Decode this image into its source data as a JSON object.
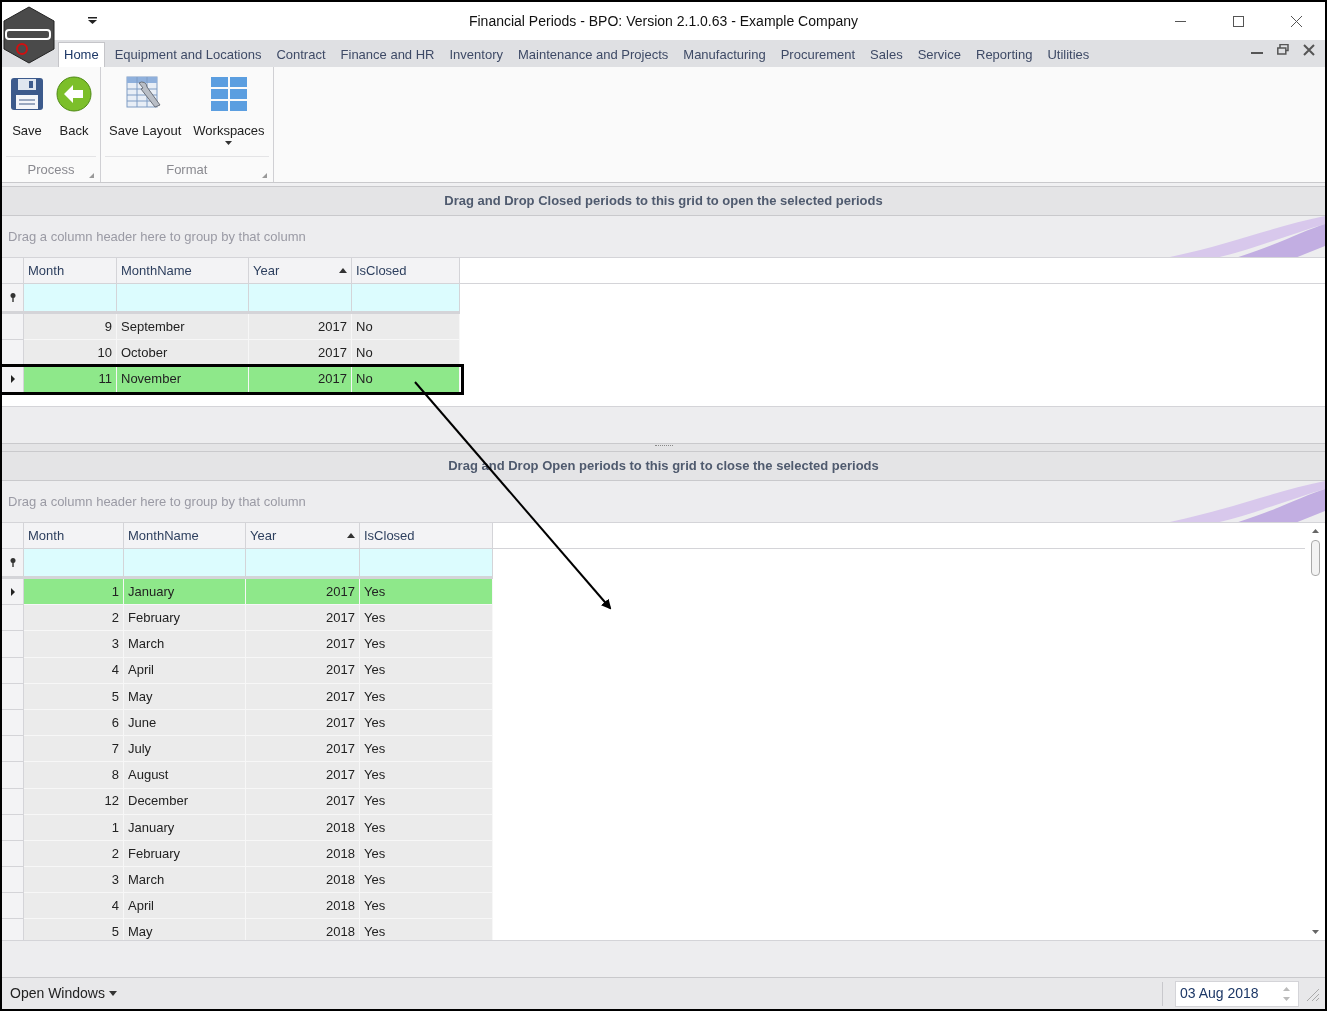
{
  "window": {
    "title": "Financial Periods - BPO: Version 2.1.0.63 - Example Company"
  },
  "ribbon_tabs": [
    {
      "label": "Home",
      "selected": true
    },
    {
      "label": "Equipment and Locations",
      "selected": false
    },
    {
      "label": "Contract",
      "selected": false
    },
    {
      "label": "Finance and HR",
      "selected": false
    },
    {
      "label": "Inventory",
      "selected": false
    },
    {
      "label": "Maintenance and Projects",
      "selected": false
    },
    {
      "label": "Manufacturing",
      "selected": false
    },
    {
      "label": "Procurement",
      "selected": false
    },
    {
      "label": "Sales",
      "selected": false
    },
    {
      "label": "Service",
      "selected": false
    },
    {
      "label": "Reporting",
      "selected": false
    },
    {
      "label": "Utilities",
      "selected": false
    }
  ],
  "ribbon_groups": [
    {
      "label": "Process",
      "buttons": [
        {
          "label": "Save",
          "kind": "save",
          "dropdown": false
        },
        {
          "label": "Back",
          "kind": "back",
          "dropdown": false
        }
      ]
    },
    {
      "label": "Format",
      "buttons": [
        {
          "label": "Save Layout",
          "kind": "layout",
          "dropdown": false
        },
        {
          "label": "Workspaces",
          "kind": "workspaces",
          "dropdown": true
        }
      ]
    }
  ],
  "grids": [
    {
      "caption": "Drag and Drop Closed periods to this grid to open the selected periods",
      "group_hint": "Drag a column header here to group by that column",
      "columns": [
        {
          "label": "Month",
          "sorted": false
        },
        {
          "label": "MonthName",
          "sorted": false
        },
        {
          "label": "Year",
          "sorted": true
        },
        {
          "label": "IsClosed",
          "sorted": false
        }
      ],
      "rows": [
        {
          "month": "9",
          "month_name": "September",
          "year": "2017",
          "is_closed": "No",
          "selected": false,
          "highlighted": false
        },
        {
          "month": "10",
          "month_name": "October",
          "year": "2017",
          "is_closed": "No",
          "selected": false,
          "highlighted": false
        },
        {
          "month": "11",
          "month_name": "November",
          "year": "2017",
          "is_closed": "No",
          "selected": true,
          "highlighted": true
        }
      ]
    },
    {
      "caption": "Drag and Drop Open periods to this grid to close the selected periods",
      "group_hint": "Drag a column header here to group by that column",
      "columns": [
        {
          "label": "Month",
          "sorted": false
        },
        {
          "label": "MonthName",
          "sorted": false
        },
        {
          "label": "Year",
          "sorted": true
        },
        {
          "label": "IsClosed",
          "sorted": false
        }
      ],
      "rows": [
        {
          "month": "1",
          "month_name": "January",
          "year": "2017",
          "is_closed": "Yes",
          "selected": true,
          "highlighted": false
        },
        {
          "month": "2",
          "month_name": "February",
          "year": "2017",
          "is_closed": "Yes",
          "selected": false,
          "highlighted": false
        },
        {
          "month": "3",
          "month_name": "March",
          "year": "2017",
          "is_closed": "Yes",
          "selected": false,
          "highlighted": false
        },
        {
          "month": "4",
          "month_name": "April",
          "year": "2017",
          "is_closed": "Yes",
          "selected": false,
          "highlighted": false
        },
        {
          "month": "5",
          "month_name": "May",
          "year": "2017",
          "is_closed": "Yes",
          "selected": false,
          "highlighted": false
        },
        {
          "month": "6",
          "month_name": "June",
          "year": "2017",
          "is_closed": "Yes",
          "selected": false,
          "highlighted": false
        },
        {
          "month": "7",
          "month_name": "July",
          "year": "2017",
          "is_closed": "Yes",
          "selected": false,
          "highlighted": false
        },
        {
          "month": "8",
          "month_name": "August",
          "year": "2017",
          "is_closed": "Yes",
          "selected": false,
          "highlighted": false
        },
        {
          "month": "12",
          "month_name": "December",
          "year": "2017",
          "is_closed": "Yes",
          "selected": false,
          "highlighted": false
        },
        {
          "month": "1",
          "month_name": "January",
          "year": "2018",
          "is_closed": "Yes",
          "selected": false,
          "highlighted": false
        },
        {
          "month": "2",
          "month_name": "February",
          "year": "2018",
          "is_closed": "Yes",
          "selected": false,
          "highlighted": false
        },
        {
          "month": "3",
          "month_name": "March",
          "year": "2018",
          "is_closed": "Yes",
          "selected": false,
          "highlighted": false
        },
        {
          "month": "4",
          "month_name": "April",
          "year": "2018",
          "is_closed": "Yes",
          "selected": false,
          "highlighted": false
        },
        {
          "month": "5",
          "month_name": "May",
          "year": "2018",
          "is_closed": "Yes",
          "selected": false,
          "highlighted": false
        }
      ]
    }
  ],
  "status_bar": {
    "open_windows": "Open Windows",
    "date": "03 Aug 2018"
  }
}
